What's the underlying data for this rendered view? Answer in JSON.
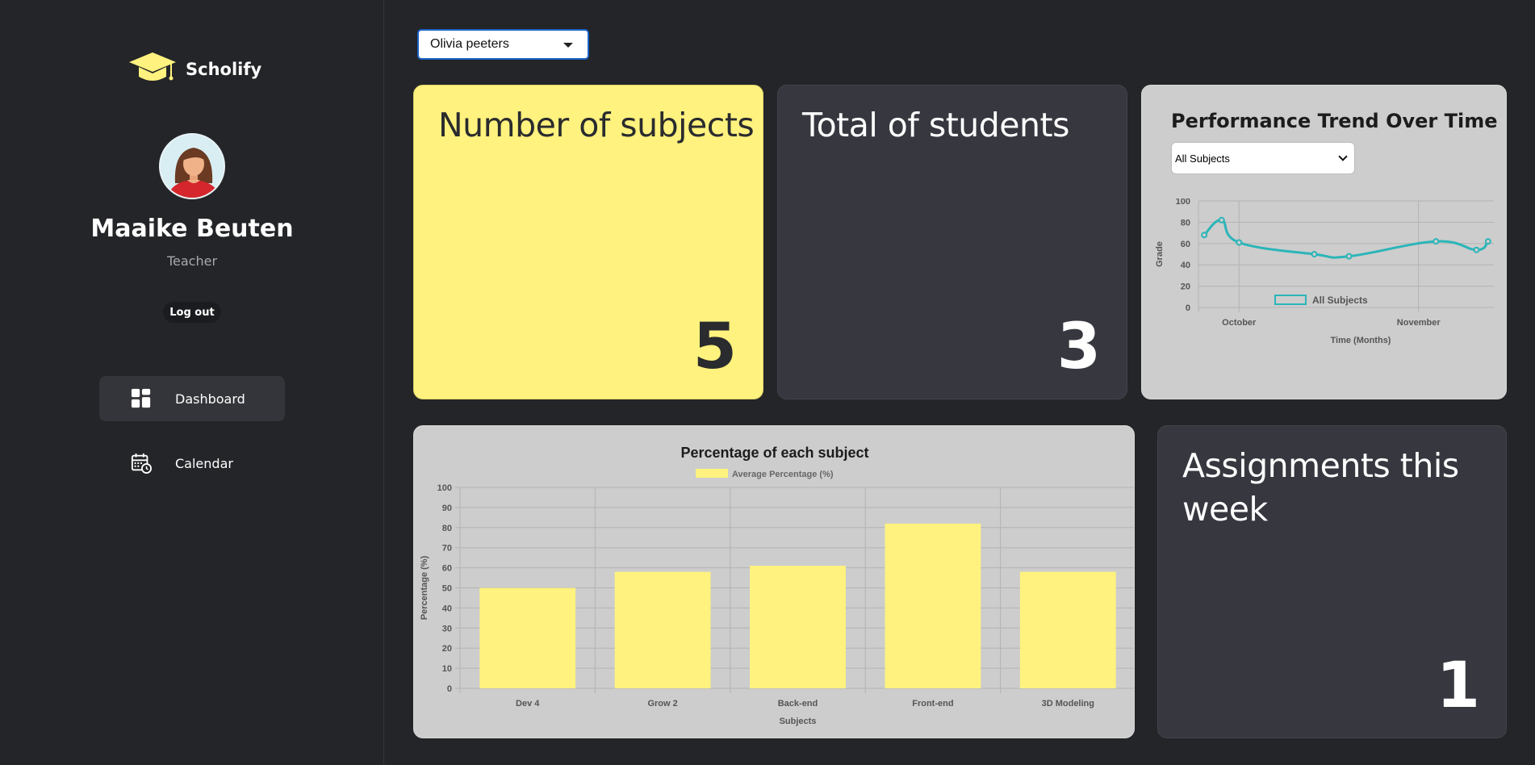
{
  "app": {
    "name": "Scholify"
  },
  "user": {
    "name": "Maaike Beuten",
    "role": "Teacher",
    "logout_label": "Log out"
  },
  "nav": {
    "items": [
      {
        "label": "Dashboard",
        "icon": "dashboard-icon",
        "active": true
      },
      {
        "label": "Calendar",
        "icon": "calendar-icon",
        "active": false
      }
    ]
  },
  "student_select": {
    "value": "Olivia peeters"
  },
  "cards": {
    "subjects": {
      "title": "Number of subjects",
      "value": "5"
    },
    "students": {
      "title": "Total of students",
      "value": "3"
    },
    "assignments": {
      "title": "Assignments this week",
      "value": "1"
    }
  },
  "trend": {
    "title": "Performance Trend Over Time",
    "select_value": "All Subjects"
  },
  "colors": {
    "yellow": "#fff27e",
    "teal": "#2bb5b8",
    "dark_card": "#36373f",
    "chart_card": "#cdcdcd"
  },
  "chart_data": [
    {
      "type": "line",
      "title": "",
      "legend": [
        "All Subjects"
      ],
      "legend_position": "top",
      "xlabel": "Time (Months)",
      "ylabel": "Grade",
      "ylim": [
        0,
        100
      ],
      "yticks": [
        0,
        20,
        40,
        60,
        80,
        100
      ],
      "xticks": [
        "October",
        "November"
      ],
      "grid": true,
      "series": [
        {
          "name": "All Subjects",
          "x": [
            "2023-09-25",
            "2023-09-28",
            "2023-10-01",
            "2023-10-14",
            "2023-10-20",
            "2023-11-04",
            "2023-11-11",
            "2023-11-13"
          ],
          "y": [
            68,
            82,
            61,
            50,
            48,
            62,
            54,
            62
          ]
        }
      ]
    },
    {
      "type": "bar",
      "title": "Percentage of each subject",
      "legend": [
        "Average Percentage (%)"
      ],
      "legend_position": "top",
      "xlabel": "Subjects",
      "ylabel": "Percentage (%)",
      "ylim": [
        0,
        100
      ],
      "yticks": [
        0,
        10,
        20,
        30,
        40,
        50,
        60,
        70,
        80,
        90,
        100
      ],
      "grid": true,
      "categories": [
        "Dev 4",
        "Grow 2",
        "Back-end",
        "Front-end",
        "3D Modeling"
      ],
      "series": [
        {
          "name": "Average Percentage (%)",
          "values": [
            50,
            58,
            61,
            82,
            58
          ]
        }
      ]
    }
  ]
}
